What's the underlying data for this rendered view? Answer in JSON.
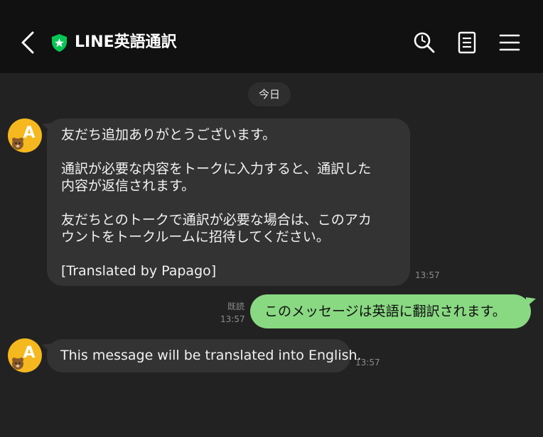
{
  "header": {
    "back_icon": "chevron-left-icon",
    "badge_icon": "shield-star-icon",
    "title": "LINE英語通訳",
    "search_icon": "search-icon",
    "notes_icon": "note-icon",
    "menu_icon": "hamburger-menu-icon"
  },
  "colors": {
    "header_bg": "#111111",
    "chat_bg": "#222222",
    "incoming_bubble": "#333333",
    "outgoing_bubble": "#89d982",
    "badge_green": "#06c755",
    "avatar_yellow": "#f5b81e"
  },
  "chat": {
    "date_label": "今日",
    "messages": [
      {
        "sender": "bot",
        "lines": [
          "友だち追加ありがとうございます。",
          "",
          "通訳が必要な内容をトークに入力すると、通訳した",
          "内容が返信されます。",
          "",
          "友だちとのトークで通訳が必要な場合は、このアカ",
          "ウントをトークルームに招待してください。",
          "",
          "[Translated by Papago]"
        ],
        "time": "13:57"
      },
      {
        "sender": "me",
        "text": "このメッセージは英語に翻訳されます。",
        "read": "既読",
        "time": "13:57"
      },
      {
        "sender": "bot",
        "text": "This message will be translated into English.",
        "time": "13:57"
      }
    ]
  }
}
